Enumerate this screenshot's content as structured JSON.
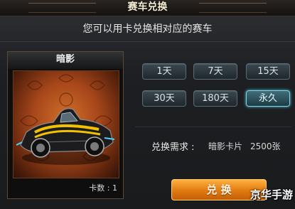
{
  "window": {
    "title": "赛车兑换"
  },
  "instruction": "您可以用卡兑换相对应的赛车",
  "car_card": {
    "name": "暗影",
    "count_label": "卡数 : 1"
  },
  "duration_options": [
    {
      "label": "1天",
      "selected": false
    },
    {
      "label": "7天",
      "selected": false
    },
    {
      "label": "15天",
      "selected": false
    },
    {
      "label": "30天",
      "selected": false
    },
    {
      "label": "180天",
      "selected": false
    },
    {
      "label": "永久",
      "selected": true
    }
  ],
  "requirement": {
    "label": "兑换需求 :",
    "item": "暗影卡片",
    "quantity": "2500张"
  },
  "exchange_button": {
    "label": "兑 换"
  },
  "watermark": "京华手游",
  "colors": {
    "selected_border": "#7fd6e8",
    "button_orange": "#e07a10"
  }
}
